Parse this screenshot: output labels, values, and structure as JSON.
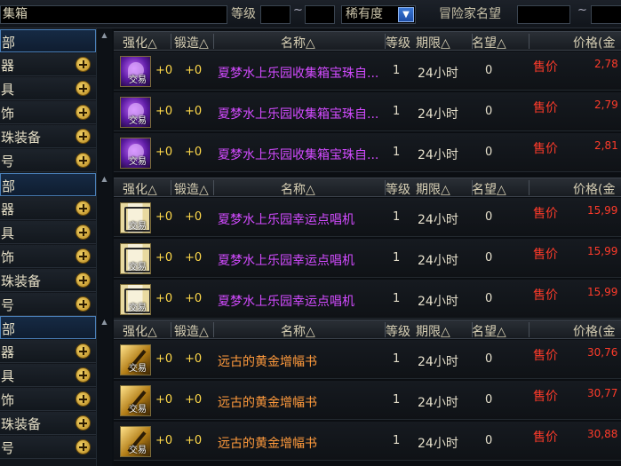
{
  "search": {
    "item_name_label": "集箱",
    "level_label": "等级",
    "level_sep": "~",
    "rarity_label": "稀有度",
    "rarity_dropdown_arrow": "▼",
    "reputation_label": "冒险家名望",
    "reputation_sep": "~"
  },
  "categories": [
    "部",
    "器",
    "具",
    "饰",
    "珠装备",
    "号"
  ],
  "scroll_up_glyph": "▲",
  "headers": {
    "enhance": "强化△",
    "forge": "锻造△",
    "name": "名称△",
    "level": "等级",
    "duration": "期限△",
    "reputation": "名望△",
    "price": "价格(金"
  },
  "badge_text": "交易",
  "sell_label": "售价",
  "groups": [
    {
      "rows": [
        {
          "icon": "purple-swimsuit-icon",
          "enhance": "+0",
          "forge": "+0",
          "name": "夏梦水上乐园收集箱宝珠自...",
          "level": "1",
          "duration": "24小时",
          "reputation": "0",
          "price": "2,78"
        },
        {
          "icon": "purple-swimsuit-icon",
          "enhance": "+0",
          "forge": "+0",
          "name": "夏梦水上乐园收集箱宝珠自...",
          "level": "1",
          "duration": "24小时",
          "reputation": "0",
          "price": "2,79"
        },
        {
          "icon": "purple-swimsuit-icon",
          "enhance": "+0",
          "forge": "+0",
          "name": "夏梦水上乐园收集箱宝珠自...",
          "level": "1",
          "duration": "24小时",
          "reputation": "0",
          "price": "2,81"
        }
      ]
    },
    {
      "rows": [
        {
          "icon": "record-player-icon",
          "enhance": "+0",
          "forge": "+0",
          "name": "夏梦水上乐园幸运点唱机",
          "level": "1",
          "duration": "24小时",
          "reputation": "0",
          "price": "15,99"
        },
        {
          "icon": "record-player-icon",
          "enhance": "+0",
          "forge": "+0",
          "name": "夏梦水上乐园幸运点唱机",
          "level": "1",
          "duration": "24小时",
          "reputation": "0",
          "price": "15,99"
        },
        {
          "icon": "record-player-icon",
          "enhance": "+0",
          "forge": "+0",
          "name": "夏梦水上乐园幸运点唱机",
          "level": "1",
          "duration": "24小时",
          "reputation": "0",
          "price": "15,99"
        }
      ]
    },
    {
      "rows": [
        {
          "icon": "golden-book-icon",
          "enhance": "+0",
          "forge": "+0",
          "name": "远古的黄金增幅书",
          "level": "1",
          "duration": "24小时",
          "reputation": "0",
          "price": "30,76"
        },
        {
          "icon": "golden-book-icon",
          "enhance": "+0",
          "forge": "+0",
          "name": "远古的黄金增幅书",
          "level": "1",
          "duration": "24小时",
          "reputation": "0",
          "price": "30,77"
        },
        {
          "icon": "golden-book-icon",
          "enhance": "+0",
          "forge": "+0",
          "name": "远古的黄金增幅书",
          "level": "1",
          "duration": "24小时",
          "reputation": "0",
          "price": "30,88"
        }
      ]
    }
  ],
  "colors": {
    "purple_name": "#d24bff",
    "orange_name": "#ff9a3c",
    "sell_red": "#ff3b2a",
    "plus_yellow": "#ffd94a"
  }
}
